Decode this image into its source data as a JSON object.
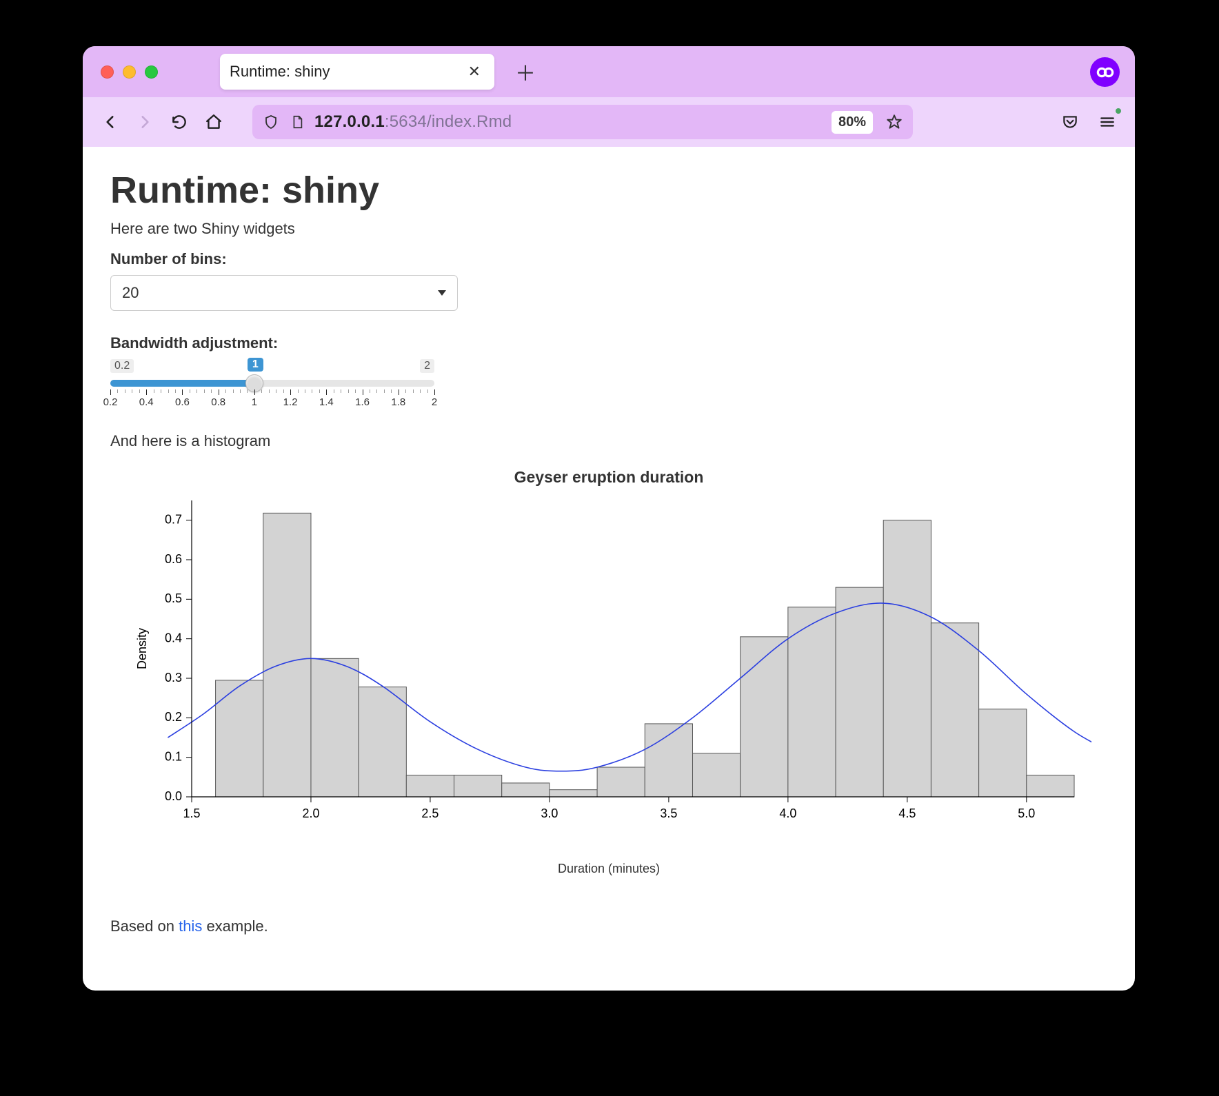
{
  "browser": {
    "tab_title": "Runtime: shiny",
    "url_host": "127.0.0.1",
    "url_rest": ":5634/index.Rmd",
    "zoom": "80%"
  },
  "page": {
    "heading": "Runtime: shiny",
    "intro": "Here are two Shiny widgets",
    "bins_label": "Number of bins:",
    "bins_value": "20",
    "bw_label": "Bandwidth adjustment:",
    "hist_intro": "And here is a histogram",
    "footer_prefix": "Based on ",
    "footer_link": "this",
    "footer_suffix": " example."
  },
  "slider": {
    "min": 0.2,
    "max": 2,
    "value": 1,
    "min_label": "0.2",
    "max_label": "2",
    "value_label": "1",
    "tick_labels": [
      "0.2",
      "0.4",
      "0.6",
      "0.8",
      "1",
      "1.2",
      "1.4",
      "1.6",
      "1.8",
      "2"
    ]
  },
  "chart_data": {
    "type": "bar",
    "title": "Geyser eruption duration",
    "xlabel": "Duration (minutes)",
    "ylabel": "Density",
    "xlim": [
      1.5,
      5.2
    ],
    "ylim": [
      0,
      0.75
    ],
    "x_ticks": [
      1.5,
      2.0,
      2.5,
      3.0,
      3.5,
      4.0,
      4.5,
      5.0
    ],
    "y_ticks": [
      0.0,
      0.1,
      0.2,
      0.3,
      0.4,
      0.5,
      0.6,
      0.7
    ],
    "bin_width": 0.2,
    "bins": [
      {
        "x": 1.6,
        "y": 0.295
      },
      {
        "x": 1.8,
        "y": 0.718
      },
      {
        "x": 2.0,
        "y": 0.35
      },
      {
        "x": 2.2,
        "y": 0.278
      },
      {
        "x": 2.4,
        "y": 0.055
      },
      {
        "x": 2.6,
        "y": 0.055
      },
      {
        "x": 2.8,
        "y": 0.035
      },
      {
        "x": 3.0,
        "y": 0.018
      },
      {
        "x": 3.2,
        "y": 0.075
      },
      {
        "x": 3.4,
        "y": 0.185
      },
      {
        "x": 3.6,
        "y": 0.11
      },
      {
        "x": 3.8,
        "y": 0.405
      },
      {
        "x": 4.0,
        "y": 0.48
      },
      {
        "x": 4.2,
        "y": 0.53
      },
      {
        "x": 4.4,
        "y": 0.7
      },
      {
        "x": 4.6,
        "y": 0.44
      },
      {
        "x": 4.8,
        "y": 0.222
      },
      {
        "x": 5.0,
        "y": 0.055
      }
    ],
    "density_curve": [
      {
        "x": 1.4,
        "y": 0.15
      },
      {
        "x": 1.55,
        "y": 0.21
      },
      {
        "x": 1.7,
        "y": 0.28
      },
      {
        "x": 1.85,
        "y": 0.33
      },
      {
        "x": 2.0,
        "y": 0.35
      },
      {
        "x": 2.15,
        "y": 0.33
      },
      {
        "x": 2.3,
        "y": 0.28
      },
      {
        "x": 2.5,
        "y": 0.19
      },
      {
        "x": 2.7,
        "y": 0.12
      },
      {
        "x": 2.9,
        "y": 0.075
      },
      {
        "x": 3.05,
        "y": 0.065
      },
      {
        "x": 3.2,
        "y": 0.075
      },
      {
        "x": 3.4,
        "y": 0.12
      },
      {
        "x": 3.6,
        "y": 0.2
      },
      {
        "x": 3.8,
        "y": 0.3
      },
      {
        "x": 4.0,
        "y": 0.4
      },
      {
        "x": 4.2,
        "y": 0.465
      },
      {
        "x": 4.4,
        "y": 0.49
      },
      {
        "x": 4.6,
        "y": 0.455
      },
      {
        "x": 4.8,
        "y": 0.37
      },
      {
        "x": 5.0,
        "y": 0.26
      },
      {
        "x": 5.2,
        "y": 0.165
      },
      {
        "x": 5.35,
        "y": 0.115
      }
    ]
  }
}
